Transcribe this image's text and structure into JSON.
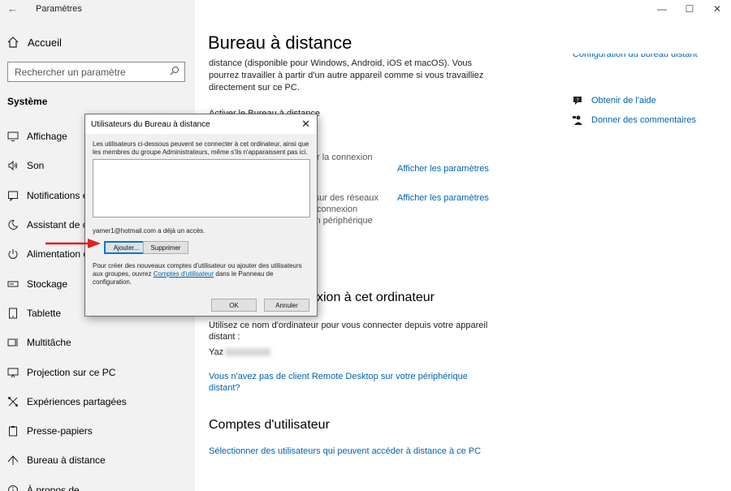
{
  "app": {
    "title": "Paramètres"
  },
  "window_controls": {
    "minimize": "—",
    "maximize": "☐",
    "close": "✕"
  },
  "sidebar": {
    "home": "Accueil",
    "search_placeholder": "Rechercher un paramètre",
    "section": "Système",
    "items": [
      {
        "label": "Affichage",
        "icon": "display-icon"
      },
      {
        "label": "Son",
        "icon": "speaker-icon"
      },
      {
        "label": "Notifications et actions",
        "icon": "notification-icon"
      },
      {
        "label": "Assistant de concentration",
        "icon": "moon-icon"
      },
      {
        "label": "Alimentation et mise en veille",
        "icon": "power-icon"
      },
      {
        "label": "Stockage",
        "icon": "storage-icon"
      },
      {
        "label": "Tablette",
        "icon": "tablet-icon"
      },
      {
        "label": "Multitâche",
        "icon": "multitask-icon"
      },
      {
        "label": "Projection sur ce PC",
        "icon": "projection-icon"
      },
      {
        "label": "Expériences partagées",
        "icon": "shared-icon"
      },
      {
        "label": "Presse-papiers",
        "icon": "clipboard-icon"
      },
      {
        "label": "Bureau à distance",
        "icon": "remote-desktop-icon"
      },
      {
        "label": "À propos de",
        "icon": "info-icon"
      }
    ]
  },
  "main": {
    "title": "Bureau à distance",
    "description": "distance (disponible pour Windows, Android, iOS et macOS). Vous pourrez travailler à partir d'un autre appareil comme si vous travailliez directement sur ce PC.",
    "enable_label": "Activer le Bureau à distance",
    "partial_1": "r la connexion",
    "partial_2": "ble sur des réseaux",
    "partial_3": "connexion",
    "partial_4": "in périphérique",
    "show_settings_1": "Afficher les paramètres",
    "show_settings_2": "Afficher les paramètres",
    "connect_heading": "xion à cet ordinateur",
    "connect_text": "Utilisez ce nom d'ordinateur pour vous connecter depuis votre appareil distant :",
    "pc_name_prefix": "Yaz",
    "no_client_link": "Vous n'avez pas de client Remote Desktop sur votre périphérique distant?",
    "accounts_heading": "Comptes d'utilisateur",
    "select_users_link": "Sélectionner des utilisateurs qui peuvent accéder à distance à ce PC"
  },
  "right_panel": {
    "config_link": "Configuration du bureau distant",
    "help": "Obtenir de l'aide",
    "feedback": "Donner des commentaires"
  },
  "dialog": {
    "title": "Utilisateurs du Bureau à distance",
    "close": "✕",
    "intro": "Les utilisateurs ci-dessous peuvent se connecter à cet ordinateur, ainsi que les membres du groupe Administrateurs, même s'ils n'apparaissent pas ici.",
    "access_text": "yamer1@hotmail.com a déjà un accès.",
    "add_button": "Ajouter...",
    "remove_button": "Supprimer",
    "info_prefix": "Pour créer des nouveaux comptes d'utilisateur ou ajouter des utilisateurs aux groupes, ouvrez ",
    "info_link": "Comptes d'utilisateur",
    "info_suffix": " dans le Panneau de configuration.",
    "ok_button": "OK",
    "cancel_button": "Annuler"
  },
  "colors": {
    "link": "#0063b1",
    "sidebar_bg": "#f2f2f2",
    "arrow": "#e02020"
  }
}
